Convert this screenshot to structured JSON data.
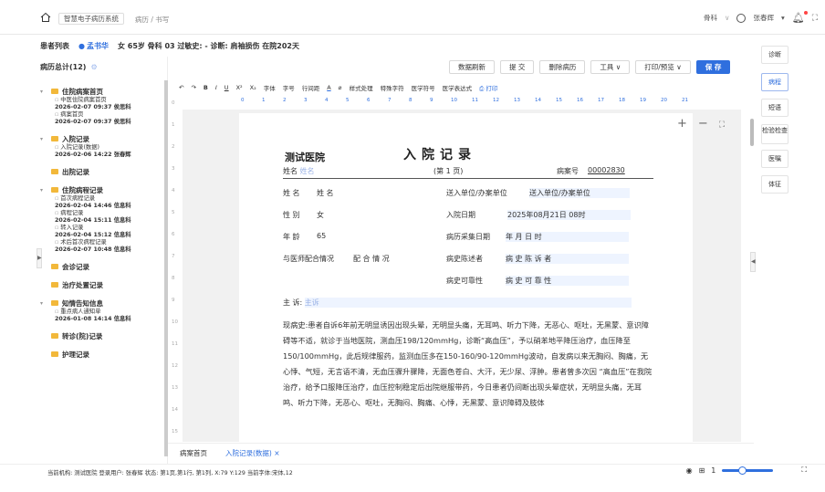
{
  "header": {
    "app_name": "智慧电子病历系统",
    "breadcrumb": "病历 / 书写",
    "department": "骨科",
    "user": "张春辉"
  },
  "patient_bar": {
    "list_label": "患者列表",
    "name": "孟书华",
    "info": "女 65岁  骨科  03  过敏史: -  诊断: 肩袖损伤  在院202天"
  },
  "left_panel": {
    "title": "病历总计(12)",
    "groups": [
      {
        "name": "住院病案首页",
        "docs": [
          {
            "title": "中医住院病案首页",
            "date": "2026-02-07 09:37  侯思科"
          },
          {
            "title": "病案首页",
            "date": "2026-02-07 09:37  侯思科"
          }
        ]
      },
      {
        "name": "入院记录",
        "docs": [
          {
            "title": "入院记录(数据)",
            "date": "2026-02-06 14:22  张春辉"
          }
        ]
      },
      {
        "name": "出院记录",
        "docs": []
      },
      {
        "name": "住院病程记录",
        "docs": [
          {
            "title": "首次病程记录",
            "date": "2026-02-04 14:46  信息科"
          },
          {
            "title": "病程记录",
            "date": "2026-02-04 15:11  信息科"
          },
          {
            "title": "转入记录",
            "date": "2026-02-04 15:12  信息科"
          },
          {
            "title": "术后首次病程记录",
            "date": "2026-02-07 10:48  信息科"
          }
        ]
      },
      {
        "name": "会诊记录",
        "docs": []
      },
      {
        "name": "治疗处置记录",
        "docs": []
      },
      {
        "name": "知情告知信息",
        "docs": [
          {
            "title": "重点病人通知单",
            "date": "2026-01-08 14:14  信息科"
          }
        ]
      },
      {
        "name": "转诊(院)记录",
        "docs": []
      },
      {
        "name": "护理记录",
        "docs": []
      }
    ]
  },
  "toolbar": {
    "refresh": "数据刷新",
    "submit": "提 交",
    "delete": "删除病历",
    "tools": "工具",
    "print_preview": "打印/预览",
    "save": "保 存"
  },
  "format_bar": {
    "items": [
      "字体",
      "字号",
      "行间距",
      "样式处理",
      "特殊字符",
      "医学符号",
      "医学表达式"
    ],
    "print": "打印"
  },
  "ruler": [
    "0",
    "1",
    "2",
    "3",
    "4",
    "5",
    "6",
    "7",
    "8",
    "9",
    "10",
    "11",
    "12",
    "13",
    "14",
    "15",
    "16",
    "17",
    "18",
    "19",
    "20",
    "21"
  ],
  "line_numbers": [
    "0",
    "1",
    "2",
    "3",
    "4",
    "5",
    "6",
    "7",
    "8",
    "9",
    "10",
    "11",
    "12",
    "13",
    "14",
    "15"
  ],
  "document": {
    "hospital": "测试医院",
    "title": "入院记录",
    "name_label": "姓名",
    "name_ph": "姓名",
    "page_label": "(第  1  页)",
    "case_label": "病案号",
    "case_no": "00002830",
    "rows": [
      {
        "l": "姓  名",
        "lv": "姓  名",
        "r": "送入单位/办案单位",
        "rv": "送入单位/办案单位"
      },
      {
        "l": "性  别",
        "lv": "女",
        "r": "入院日期",
        "rv": "2025年08月21日 08时"
      },
      {
        "l": "年  龄",
        "lv": "65",
        "r": "病历采集日期",
        "rv": "年    月    日    时"
      },
      {
        "l": "与医师配合情况",
        "lv": "配 合 情 况",
        "r": "病史陈述者",
        "rv": "病    史    陈    诉    者"
      },
      {
        "l": "",
        "lv": "",
        "r": "病史可靠性",
        "rv": "病    史    可    靠    性"
      }
    ],
    "chief_label": "主  诉:",
    "chief_value": "主诉",
    "hpi_label": "现病史:",
    "hpi_text": "患者自诉6年前无明显诱因出现头晕，无明显头痛，无耳鸣、听力下降，无恶心、呕吐，无黑蒙、意识障碍等不适，就诊于当地医院，测血压198/120mmHg，诊断“高血压”，予以硝苯地平降压治疗，血压降至150/100mmHg，此后规律服药，监测血压多在150-160/90-120mmHg波动，自发病以来无胸闷、胸痛，无心悸、气短，无言语不清，无血压骤升骤降，无面色苍白、大汗，无少尿、浮肿。患者曾多次因 “高血压”在我院治疗，给予口服降压治疗，血压控制稳定后出院继服带药，今日患者仍间断出现头晕症状，无明显头痛，无耳鸣、听力下降，无恶心、呕吐，无胸闷、胸痛、心悸，无黑蒙、意识障碍及肢体"
  },
  "tabs": [
    "病案首页",
    "入院记录(数据)"
  ],
  "right_buttons": [
    "诊断",
    "医嘱",
    "病程",
    "短语",
    "检验检查",
    "医嘱",
    "体征"
  ],
  "status": "当前机构: 测试医院  登录用户: 张春辉  状态: 第1页,第1行, 第1列, X:79 Y:129 当前字体:宋体,12",
  "zoom_value": "1",
  "colors": {
    "accent": "#2f6fde",
    "folder": "#f2b83a"
  }
}
